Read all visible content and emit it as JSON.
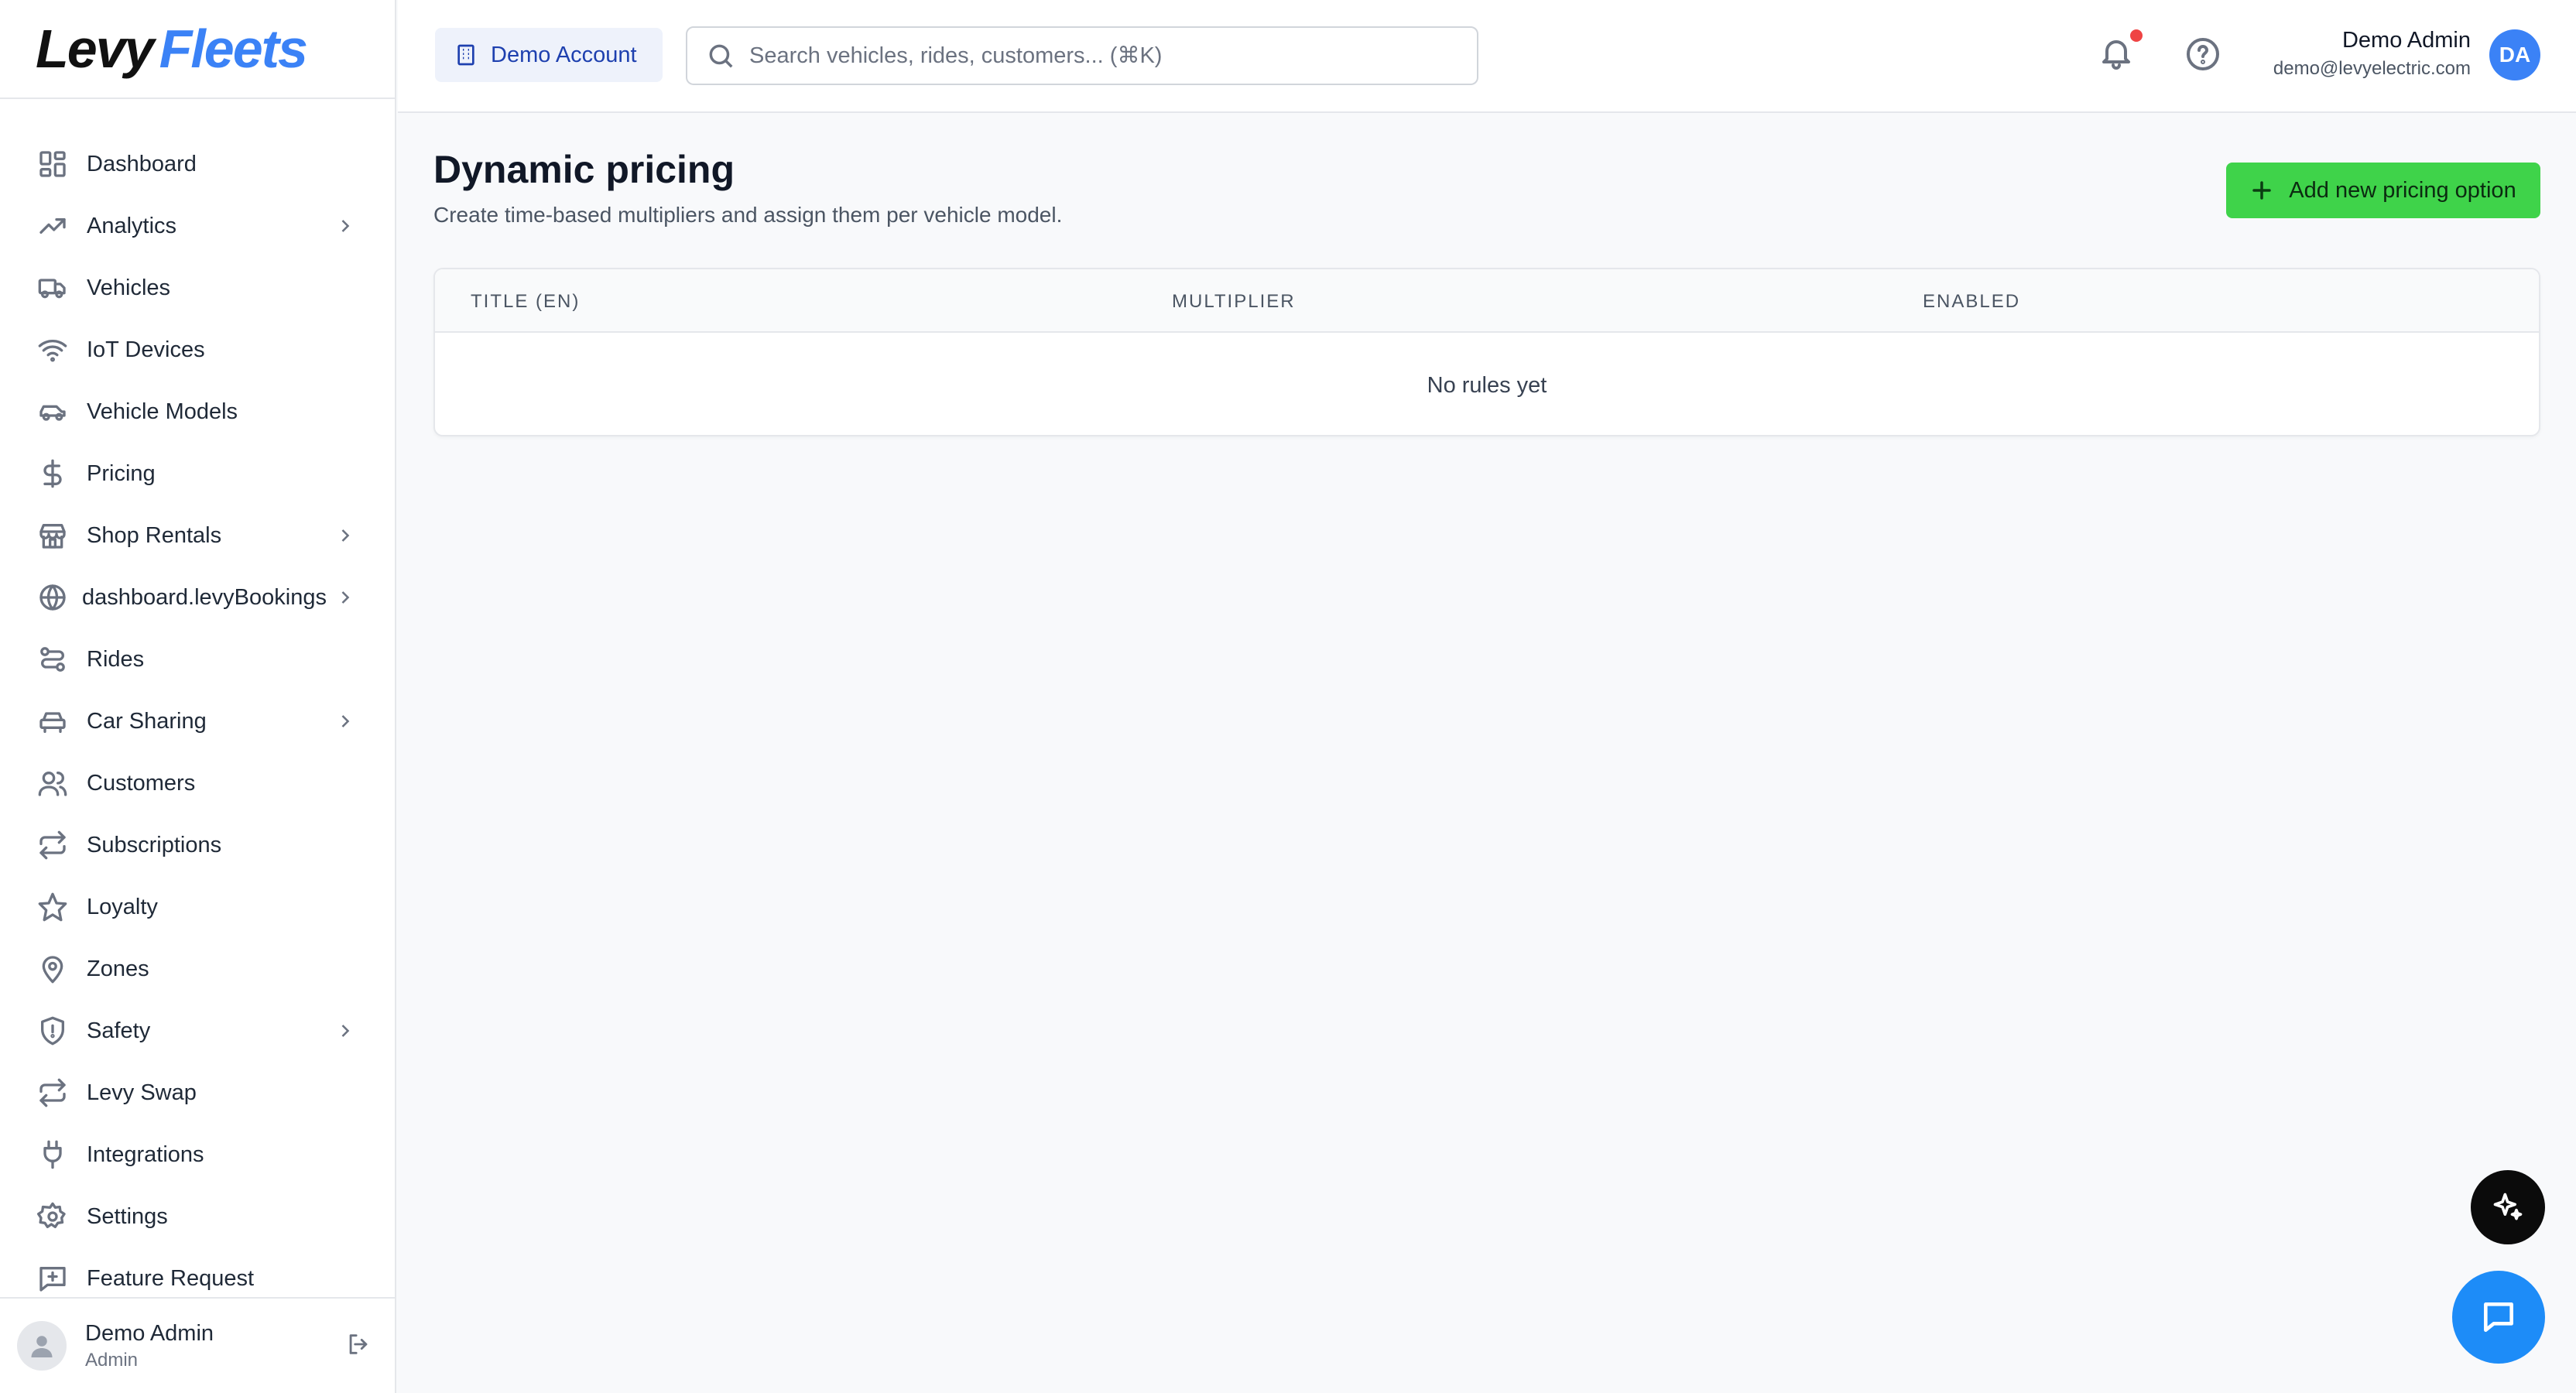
{
  "brand": {
    "part1": "Levy",
    "part2": "Fleets",
    "accent_color": "#3b82f6"
  },
  "sidebar": {
    "items": [
      {
        "label": "Dashboard",
        "icon": "dashboard-icon",
        "has_submenu": false
      },
      {
        "label": "Analytics",
        "icon": "trending-up-icon",
        "has_submenu": true
      },
      {
        "label": "Vehicles",
        "icon": "truck-icon",
        "has_submenu": false
      },
      {
        "label": "IoT Devices",
        "icon": "wifi-icon",
        "has_submenu": false
      },
      {
        "label": "Vehicle Models",
        "icon": "car-icon",
        "has_submenu": false
      },
      {
        "label": "Pricing",
        "icon": "dollar-icon",
        "has_submenu": false
      },
      {
        "label": "Shop Rentals",
        "icon": "store-icon",
        "has_submenu": true
      },
      {
        "label": "dashboard.levyBookings",
        "icon": "globe-icon",
        "has_submenu": true
      },
      {
        "label": "Rides",
        "icon": "route-icon",
        "has_submenu": false
      },
      {
        "label": "Car Sharing",
        "icon": "car-front-icon",
        "has_submenu": true
      },
      {
        "label": "Customers",
        "icon": "users-icon",
        "has_submenu": false
      },
      {
        "label": "Subscriptions",
        "icon": "repeat-icon",
        "has_submenu": false
      },
      {
        "label": "Loyalty",
        "icon": "star-icon",
        "has_submenu": false
      },
      {
        "label": "Zones",
        "icon": "map-pin-icon",
        "has_submenu": false
      },
      {
        "label": "Safety",
        "icon": "shield-icon",
        "has_submenu": true
      },
      {
        "label": "Levy Swap",
        "icon": "swap-icon",
        "has_submenu": false
      },
      {
        "label": "Integrations",
        "icon": "plug-icon",
        "has_submenu": false
      },
      {
        "label": "Settings",
        "icon": "gear-icon",
        "has_submenu": false
      },
      {
        "label": "Feature Request",
        "icon": "message-plus-icon",
        "has_submenu": false
      }
    ],
    "footer": {
      "name": "Demo Admin",
      "role": "Admin"
    }
  },
  "header": {
    "account_label": "Demo Account",
    "search_placeholder": "Search vehicles, rides, customers... (⌘K)",
    "user": {
      "name": "Demo Admin",
      "email": "demo@levyelectric.com",
      "initials": "DA"
    },
    "notification_dot_color": "#ef4444"
  },
  "main": {
    "title": "Dynamic pricing",
    "subtitle": "Create time-based multipliers and assign them per vehicle model.",
    "add_button_label": "Add new pricing option",
    "add_button_color": "#3fd34a",
    "table": {
      "columns": [
        "TITLE (EN)",
        "MULTIPLIER",
        "ENABLED"
      ],
      "rows": [],
      "empty_message": "No rules yet"
    }
  }
}
